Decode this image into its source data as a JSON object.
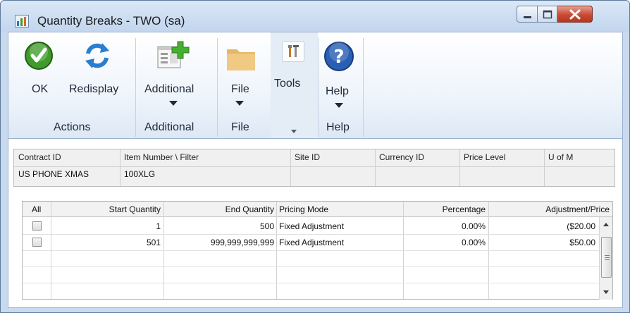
{
  "window": {
    "title": "Quantity Breaks  -  TWO (sa)",
    "controls": [
      "minimize",
      "maximize",
      "close"
    ]
  },
  "ribbon": {
    "ok_label": "OK",
    "redisplay_label": "Redisplay",
    "actions_group": "Actions",
    "additional_label": "Additional",
    "additional_group": "Additional",
    "file_label": "File",
    "file_group": "File",
    "tools_label": "Tools",
    "help_label": "Help",
    "help_group": "Help"
  },
  "header_panel": {
    "columns": [
      "Contract ID",
      "Item Number \\ Filter",
      "Site ID",
      "Currency ID",
      "Price Level",
      "U of M"
    ],
    "values": [
      "US PHONE XMAS",
      "100XLG",
      "",
      "",
      "",
      ""
    ]
  },
  "grid": {
    "columns": [
      "All",
      "Start Quantity",
      "End Quantity",
      "Pricing Mode",
      "Percentage",
      "Adjustment/Price"
    ],
    "rows": [
      {
        "checked": false,
        "start": "1",
        "end": "500",
        "mode": "Fixed Adjustment",
        "percentage": "0.00%",
        "adjustment": "($20.00"
      },
      {
        "checked": false,
        "start": "501",
        "end": "999,999,999,999",
        "mode": "Fixed Adjustment",
        "percentage": "0.00%",
        "adjustment": "$50.00"
      }
    ]
  },
  "colors": {
    "accent_green": "#3f9b2a",
    "accent_blue": "#2a73c8",
    "close_red": "#c74b34",
    "ribbon_border": "#9ab1cf"
  },
  "icons": {
    "ok": "check-circle-icon",
    "redisplay": "refresh-icon",
    "additional": "window-add-icon",
    "file": "folder-icon",
    "tools": "tools-icon",
    "help": "question-circle-icon"
  }
}
